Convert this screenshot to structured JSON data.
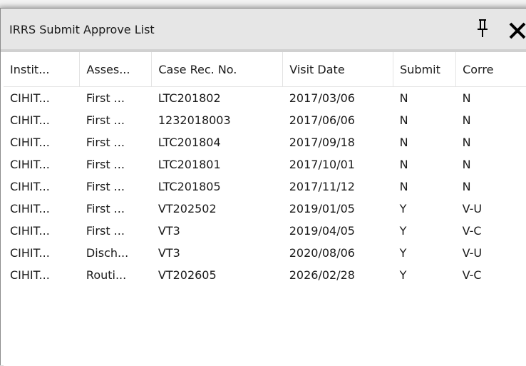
{
  "window": {
    "title": "IRRS Submit Approve List"
  },
  "icons": {
    "pin": "pin-icon",
    "close": "close-icon"
  },
  "table": {
    "columns": [
      "Instit...",
      "Asses...",
      "Case Rec. No.",
      "Visit Date",
      "Submit",
      "Corre"
    ],
    "rows": [
      [
        "CIHIT...",
        "First ...",
        "LTC201802",
        "2017/03/06",
        "N",
        "N"
      ],
      [
        "CIHIT...",
        "First ...",
        "1232018003",
        "2017/06/06",
        "N",
        "N"
      ],
      [
        "CIHIT...",
        "First ...",
        "LTC201804",
        "2017/09/18",
        "N",
        "N"
      ],
      [
        "CIHIT...",
        "First ...",
        "LTC201801",
        "2017/10/01",
        "N",
        "N"
      ],
      [
        "CIHIT...",
        "First ...",
        "LTC201805",
        "2017/11/12",
        "N",
        "N"
      ],
      [
        "CIHIT...",
        "First ...",
        "VT202502",
        "2019/01/05",
        "Y",
        "V-U"
      ],
      [
        "CIHIT...",
        "First ...",
        "VT3",
        "2019/04/05",
        "Y",
        "V-C"
      ],
      [
        "CIHIT...",
        "Disch...",
        "VT3",
        "2020/08/06",
        "Y",
        "V-U"
      ],
      [
        "CIHIT...",
        "Routi...",
        "VT202605",
        "2026/02/28",
        "Y",
        "V-C"
      ]
    ]
  }
}
